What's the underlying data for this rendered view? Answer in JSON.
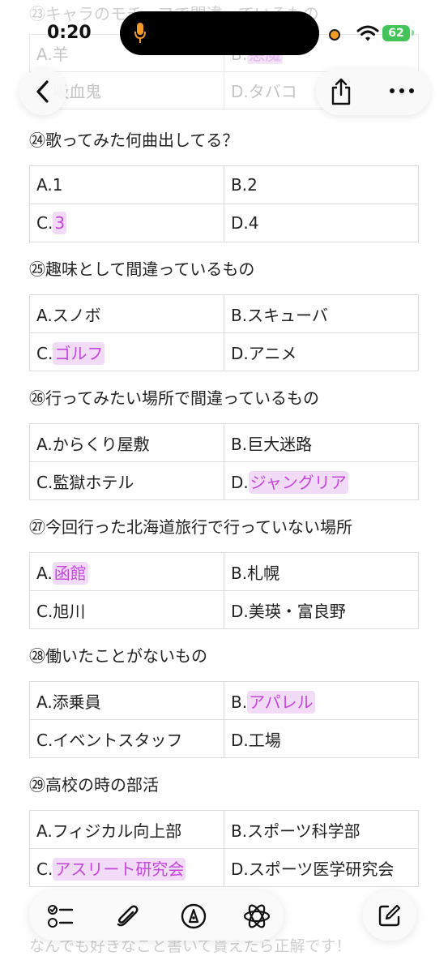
{
  "status_bar": {
    "time": "0:20",
    "battery": "62"
  },
  "faded_top": {
    "title": "㉓キャラのモチーフで間違っているもの",
    "options": [
      {
        "prefix": "A.",
        "text": "羊",
        "highlight": false
      },
      {
        "prefix": "B.",
        "text": "悪魔",
        "highlight": true
      },
      {
        "prefix": "C.",
        "text": "吸血鬼",
        "highlight": false
      },
      {
        "prefix": "D.",
        "text": "タバコ",
        "highlight": false
      }
    ]
  },
  "questions": [
    {
      "title": "㉔歌ってみた何曲出してる？",
      "options": [
        {
          "prefix": "A.",
          "text": "1",
          "highlight": false
        },
        {
          "prefix": "B.",
          "text": "2",
          "highlight": false
        },
        {
          "prefix": "C.",
          "text": "3",
          "highlight": true
        },
        {
          "prefix": "D.",
          "text": "4",
          "highlight": false
        }
      ]
    },
    {
      "title": "㉕趣味として間違っているもの",
      "options": [
        {
          "prefix": "A.",
          "text": "スノボ",
          "highlight": false
        },
        {
          "prefix": "B.",
          "text": "スキューバ",
          "highlight": false
        },
        {
          "prefix": "C.",
          "text": "ゴルフ",
          "highlight": true
        },
        {
          "prefix": "D.",
          "text": "アニメ",
          "highlight": false
        }
      ]
    },
    {
      "title": "㉖行ってみたい場所で間違っているもの",
      "options": [
        {
          "prefix": "A.",
          "text": "からくり屋敷",
          "highlight": false
        },
        {
          "prefix": "B.",
          "text": "巨大迷路",
          "highlight": false
        },
        {
          "prefix": "C.",
          "text": "監獄ホテル",
          "highlight": false
        },
        {
          "prefix": "D.",
          "text": "ジャングリア",
          "highlight": true
        }
      ]
    },
    {
      "title": "㉗今回行った北海道旅行で行っていない場所",
      "options": [
        {
          "prefix": "A.",
          "text": "函館",
          "highlight": true
        },
        {
          "prefix": "B.",
          "text": "札幌",
          "highlight": false
        },
        {
          "prefix": "C.",
          "text": "旭川",
          "highlight": false
        },
        {
          "prefix": "D.",
          "text": "美瑛・富良野",
          "highlight": false
        }
      ]
    },
    {
      "title": "㉘働いたことがないもの",
      "options": [
        {
          "prefix": "A.",
          "text": "添乗員",
          "highlight": false
        },
        {
          "prefix": "B.",
          "text": "アパレル",
          "highlight": true
        },
        {
          "prefix": "C.",
          "text": "イベントスタッフ",
          "highlight": false
        },
        {
          "prefix": "D.",
          "text": "工場",
          "highlight": false
        }
      ]
    },
    {
      "title": "㉙高校の時の部活",
      "options": [
        {
          "prefix": "A.",
          "text": "フィジカル向上部",
          "highlight": false
        },
        {
          "prefix": "B.",
          "text": "スポーツ科学部",
          "highlight": false
        },
        {
          "prefix": "C.",
          "text": "アスリート研究会",
          "highlight": true
        },
        {
          "prefix": "D.",
          "text": "スポーツ医学研究会",
          "highlight": false
        }
      ]
    }
  ],
  "faded_bottom": {
    "text": "なんでも好きなこと書いて貰えたら正解です！"
  },
  "colors": {
    "highlight_bg": "#f1dbf7",
    "highlight_text": "#c247d8",
    "battery": "#43c45a",
    "recording_dot": "#f09a2b"
  },
  "icons": [
    "back-chevron-icon",
    "share-icon",
    "more-icon",
    "checklist-icon",
    "paperclip-icon",
    "markup-pen-icon",
    "ai-atom-icon",
    "compose-icon",
    "microphone-icon",
    "wifi-icon"
  ]
}
